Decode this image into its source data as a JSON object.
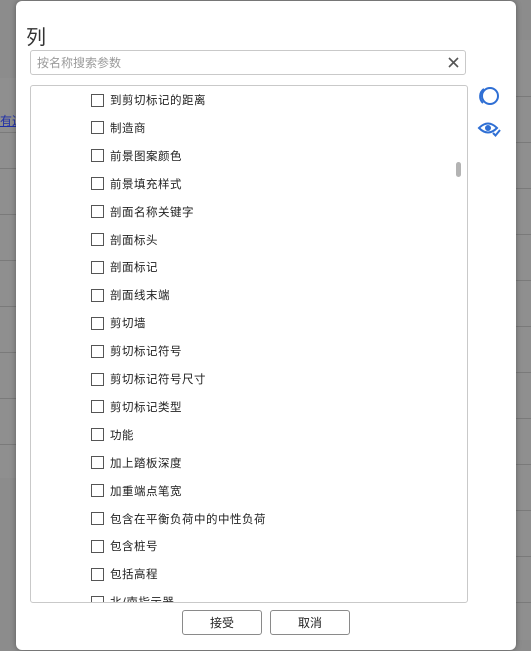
{
  "background": {
    "link_fragment": "有这"
  },
  "dialog": {
    "title": "列",
    "search": {
      "placeholder": "按名称搜索参数",
      "value": ""
    },
    "items": [
      {
        "label": "到剪切标记的距离",
        "checked": false
      },
      {
        "label": "制造商",
        "checked": false
      },
      {
        "label": "前景图案颜色",
        "checked": false
      },
      {
        "label": "前景填充样式",
        "checked": false
      },
      {
        "label": "剖面名称关键字",
        "checked": false
      },
      {
        "label": "剖面标头",
        "checked": false
      },
      {
        "label": "剖面标记",
        "checked": false
      },
      {
        "label": "剖面线末端",
        "checked": false
      },
      {
        "label": "剪切墙",
        "checked": false
      },
      {
        "label": "剪切标记符号",
        "checked": false
      },
      {
        "label": "剪切标记符号尺寸",
        "checked": false
      },
      {
        "label": "剪切标记类型",
        "checked": false
      },
      {
        "label": "功能",
        "checked": false
      },
      {
        "label": "加上踏板深度",
        "checked": false
      },
      {
        "label": "加重端点笔宽",
        "checked": false
      },
      {
        "label": "包含在平衡负荷中的中性负荷",
        "checked": false
      },
      {
        "label": "包含桩号",
        "checked": false
      },
      {
        "label": "包括高程",
        "checked": false
      },
      {
        "label": "北/南指示器",
        "checked": false
      }
    ],
    "accept_label": "接受",
    "cancel_label": "取消"
  },
  "colors": {
    "accent": "#2f6fd4",
    "overlay": "#8c8c8c"
  },
  "icons": {
    "clear": "close-icon",
    "select_all": "circle-select-icon",
    "show_selected": "eye-check-icon"
  }
}
